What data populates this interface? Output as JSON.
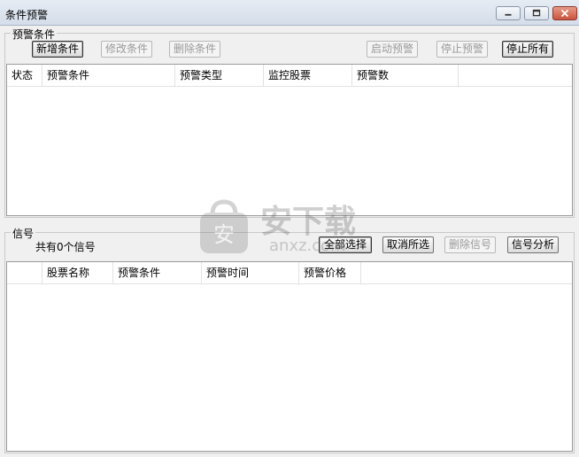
{
  "window": {
    "title": "条件预警",
    "controls": [
      "minimize-icon",
      "restore-icon",
      "close-icon"
    ]
  },
  "alert_conditions": {
    "group_label": "预警条件",
    "buttons": {
      "add": "新增条件",
      "edit": "修改条件",
      "delete": "删除条件",
      "start": "启动预警",
      "stop": "停止预警",
      "stop_all": "停止所有"
    },
    "columns": [
      "状态",
      "预警条件",
      "预警类型",
      "监控股票",
      "预警数"
    ],
    "rows": []
  },
  "signals": {
    "group_label": "信号",
    "count_text": "共有0个信号",
    "buttons": {
      "select_all": "全部选择",
      "deselect_all": "取消所选",
      "delete": "删除信号",
      "analyze": "信号分析"
    },
    "columns": [
      "",
      "股票名称",
      "预警条件",
      "预警时间",
      "预警价格"
    ],
    "rows": []
  },
  "watermark": {
    "text_cn": "安下载",
    "text_en": "anxz.com"
  }
}
